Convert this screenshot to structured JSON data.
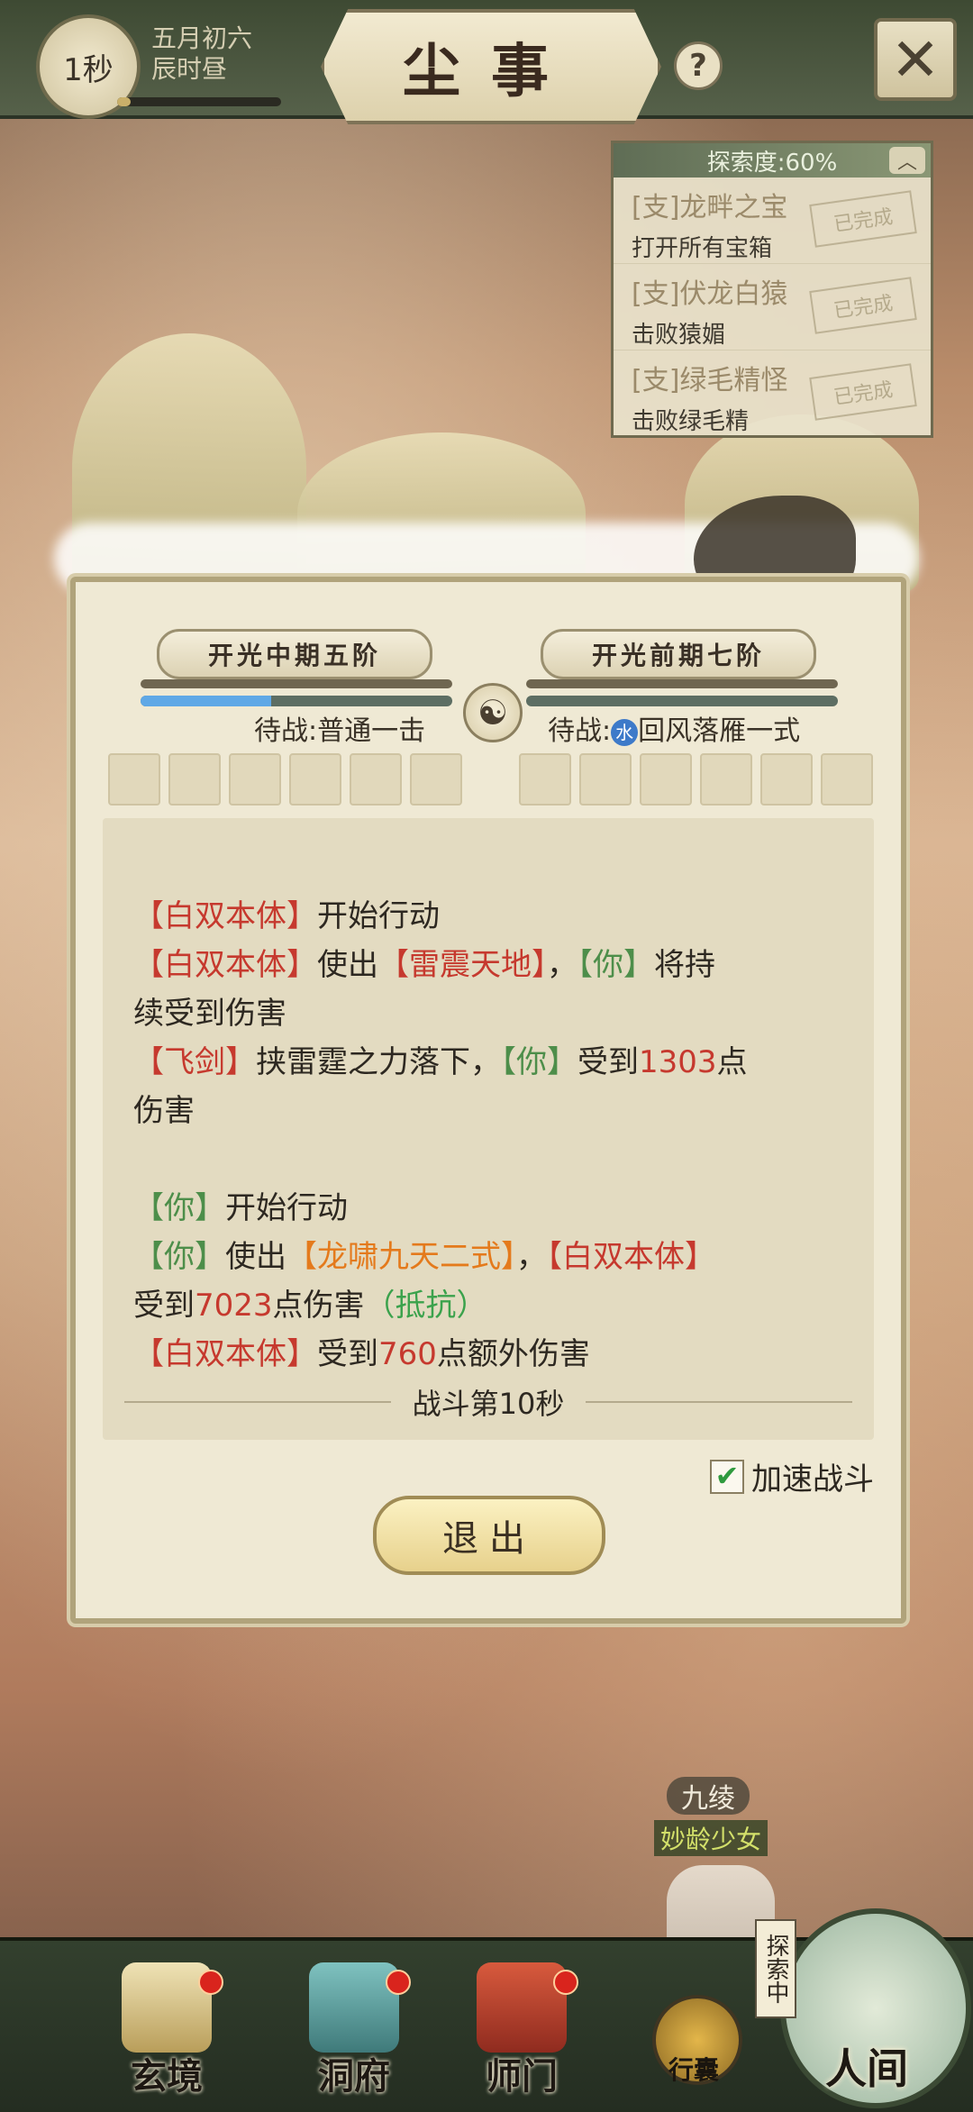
{
  "header": {
    "timer": "1秒",
    "date_line1": "五月初六",
    "date_line2": "辰时昼",
    "timer_progress": 0.08,
    "title": "尘事",
    "help_icon": "question-mark-icon",
    "close_icon": "close-x-icon"
  },
  "quests": {
    "header": "探索度:60%",
    "items": [
      {
        "name": "[支]龙畔之宝",
        "desc": "打开所有宝箱",
        "status": "已完成"
      },
      {
        "name": "[支]伏龙白猿",
        "desc": "击败猿媚",
        "status": "已完成"
      },
      {
        "name": "[支]绿毛精怪",
        "desc": "击败绿毛精",
        "status": "已完成"
      }
    ]
  },
  "battle": {
    "left_realm": "开光中期五阶",
    "right_realm": "开光前期七阶",
    "left_mp_fill": 0.42,
    "right_mp_fill": 0.0,
    "left_standby": "待战:普通一击",
    "right_standby_prefix": "待战:",
    "right_standby_element": "水",
    "right_standby_skill": "回风落雁一式",
    "log": {
      "l1a": "【白双本体】",
      "l1b": "开始行动",
      "l2a": "【白双本体】",
      "l2b": "使出",
      "l2c": "【雷震天地】",
      "l2d": "，",
      "l2e": "【你】",
      "l2f": "将持",
      "l3": "续受到伤害",
      "l4a": "【飞剑】",
      "l4b": "挟雷霆之力落下，",
      "l4c": "【你】",
      "l4d": "受到",
      "l4e": "1303",
      "l4f": "点",
      "l5": "伤害",
      "l6a": "【你】",
      "l6b": "开始行动",
      "l7a": "【你】",
      "l7b": "使出",
      "l7c": "【龙啸九天二式】",
      "l7d": "，",
      "l7e": "【白双本体】",
      "l8a": "受到",
      "l8b": "7023",
      "l8c": "点伤害",
      "l8d": "（抵抗）",
      "l9a": "【白双本体】",
      "l9b": "受到",
      "l9c": "760",
      "l9d": "点额外伤害"
    },
    "second_label": "战斗第10秒",
    "speed_label": "加速战斗",
    "speed_checked": true,
    "exit_label": "退出"
  },
  "npc": {
    "name": "九绫",
    "title": "妙龄少女"
  },
  "nav": {
    "items": [
      "玄境",
      "洞府",
      "师门"
    ],
    "bag_label": "行囊",
    "explore_tag": "探索中",
    "world_label": "人间"
  },
  "colors": {
    "enemy": "#c6392e",
    "player": "#4d8e4a",
    "skill": "#e47a1c",
    "resist": "#3ba24c"
  }
}
